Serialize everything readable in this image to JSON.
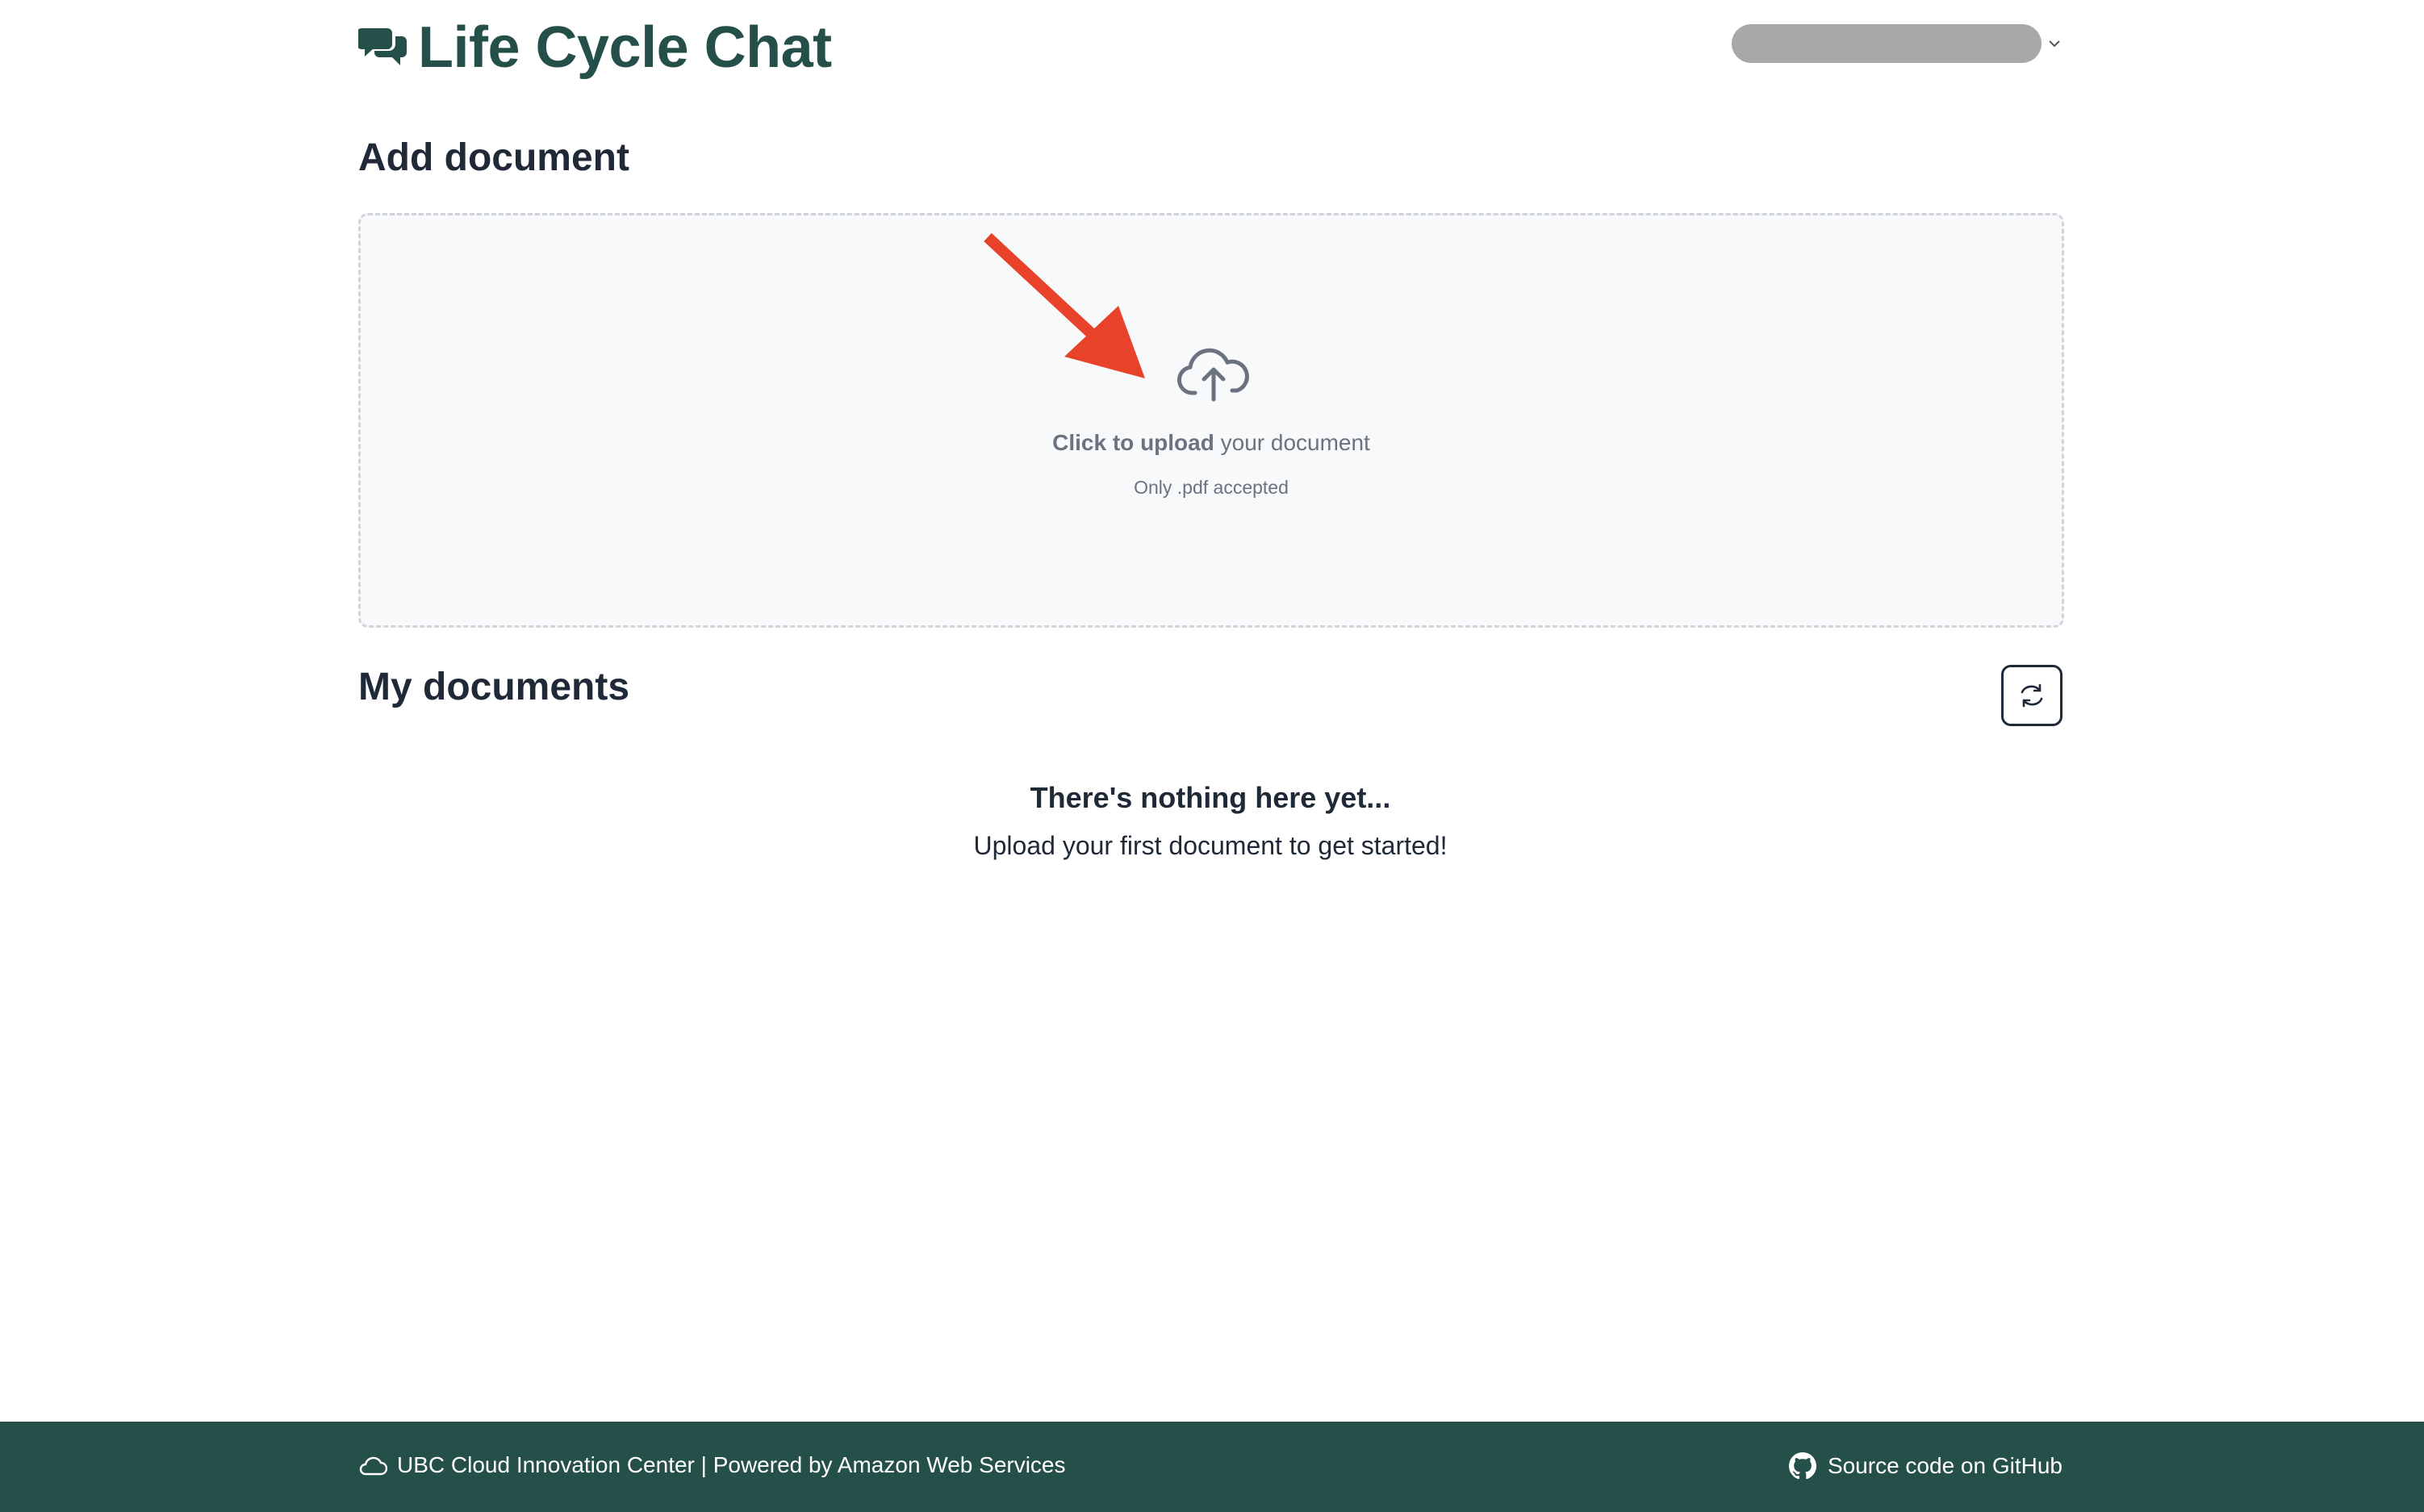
{
  "header": {
    "app_title": "Life Cycle Chat",
    "logo_icon": "chat-bubbles-icon",
    "user_menu_icon": "chevron-down-icon"
  },
  "add_document": {
    "title": "Add document",
    "upload_strong": "Click to upload",
    "upload_rest": " your document",
    "upload_hint": "Only .pdf accepted",
    "icon": "cloud-upload-icon"
  },
  "my_documents": {
    "title": "My documents",
    "refresh_icon": "refresh-icon",
    "empty_title": "There's nothing here yet...",
    "empty_subtitle": "Upload your first document to get started!"
  },
  "footer": {
    "left_text": "UBC Cloud Innovation Center | Powered by Amazon Web Services",
    "right_text": "Source code on GitHub",
    "left_icon": "cloud-icon",
    "right_icon": "github-icon"
  },
  "colors": {
    "brand": "#245049",
    "annotation_arrow": "#e8432a",
    "dropzone_bg": "#f8f9fa",
    "muted_text": "#6b7280"
  }
}
